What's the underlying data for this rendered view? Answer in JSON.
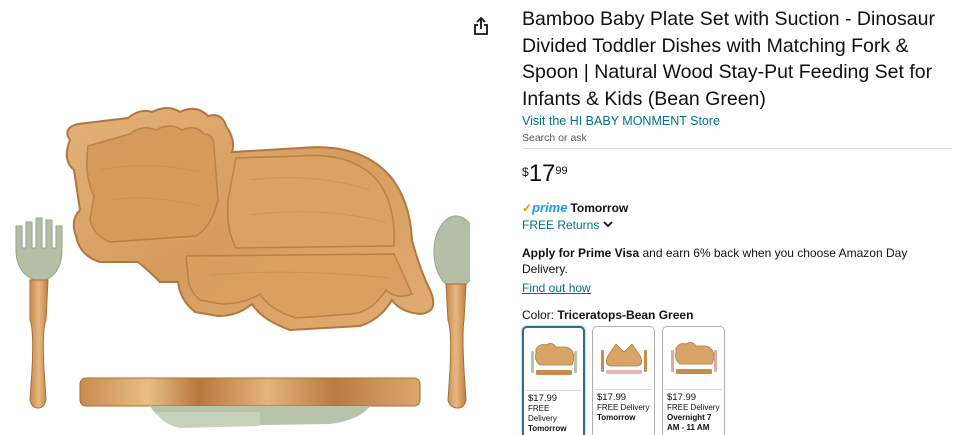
{
  "product": {
    "title": "Bamboo Baby Plate Set with Suction - Dinosaur Divided Toddler Dishes with Matching Fork & Spoon | Natural Wood Stay-Put Feeding Set for Infants & Kids (Bean Green)",
    "store_link": "Visit the HI BABY MONMENT Store",
    "search_ask": "Search or ask"
  },
  "price": {
    "symbol": "$",
    "whole": "17",
    "fraction": "99"
  },
  "delivery": {
    "prime_check": "✓",
    "prime_label": "prime",
    "prime_when": "Tomorrow",
    "returns_label": "FREE Returns",
    "returns_chevron": "⌄"
  },
  "offer": {
    "bold": "Apply for Prime Visa",
    "text": " and earn 6% back when you choose Amazon Day Delivery.",
    "link": "Find out how"
  },
  "color": {
    "label": "Color: ",
    "selected": "Triceratops-Bean Green",
    "swatches": [
      {
        "price": "$17.99",
        "delivery": "FREE Delivery",
        "when": "Tomorrow"
      },
      {
        "price": "$17.99",
        "delivery": "FREE Delivery",
        "when": "Tomorrow"
      },
      {
        "price": "$17.99",
        "delivery": "FREE Delivery",
        "when": "Overnight 7 AM - 11 AM"
      }
    ]
  },
  "icons": {
    "share": "share-icon",
    "product_image": "product-image"
  },
  "colors": {
    "bamboo": "#d9a468",
    "bamboo_dark": "#b97c42",
    "silicone_green": "#b9c3ac",
    "link": "#007185",
    "prime_blue": "#1a98ff",
    "prime_orange": "#f08804",
    "selected_border": "#2e6b8f"
  }
}
